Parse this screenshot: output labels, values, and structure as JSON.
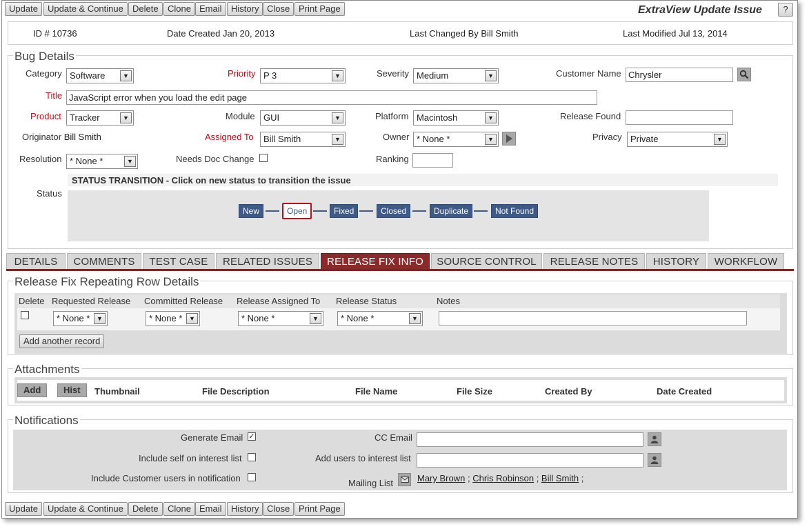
{
  "toolbar": {
    "buttons": [
      "Update",
      "Update & Continue",
      "Delete",
      "Clone",
      "Email",
      "History",
      "Close",
      "Print Page"
    ],
    "app_title": "ExtraView Update Issue",
    "help_label": "?"
  },
  "summary": {
    "id_label": "ID #",
    "id_value": "10736",
    "date_created_label": "Date Created",
    "date_created_value": "Jan 20, 2013",
    "last_changed_by_label": "Last Changed By",
    "last_changed_by_value": "Bill Smith",
    "last_modified_label": "Last Modified",
    "last_modified_value": "Jul 13, 2014"
  },
  "bug_details": {
    "title": "Bug Details",
    "category": {
      "label": "Category",
      "value": "Software"
    },
    "priority": {
      "label": "Priority",
      "value": "P 3"
    },
    "severity": {
      "label": "Severity",
      "value": "Medium"
    },
    "customer_name": {
      "label": "Customer Name",
      "value": "Chrysler"
    },
    "title_field": {
      "label": "Title",
      "value": "JavaScript error when you load the edit page"
    },
    "product": {
      "label": "Product",
      "value": "Tracker"
    },
    "module": {
      "label": "Module",
      "value": "GUI"
    },
    "platform": {
      "label": "Platform",
      "value": "Macintosh"
    },
    "release_found": {
      "label": "Release Found",
      "value": ""
    },
    "originator": {
      "label": "Originator",
      "value": "Bill Smith"
    },
    "assigned_to": {
      "label": "Assigned To",
      "value": "Bill Smith"
    },
    "owner": {
      "label": "Owner",
      "value": "* None *"
    },
    "privacy": {
      "label": "Privacy",
      "value": "Private"
    },
    "resolution": {
      "label": "Resolution",
      "value": "* None *"
    },
    "needs_doc_change": {
      "label": "Needs Doc Change",
      "checked": false
    },
    "ranking": {
      "label": "Ranking",
      "value": ""
    },
    "status_transition_label": "STATUS TRANSITION - Click on new status to transition the issue",
    "status_label": "Status",
    "statuses": [
      "New",
      "Open",
      "Fixed",
      "Closed",
      "Duplicate",
      "Not Found"
    ],
    "current_status": "Open"
  },
  "tabs": [
    "DETAILS",
    "COMMENTS",
    "TEST CASE",
    "RELATED ISSUES",
    "RELEASE FIX INFO",
    "SOURCE CONTROL",
    "RELEASE NOTES",
    "HISTORY",
    "WORKFLOW"
  ],
  "active_tab": "RELEASE FIX INFO",
  "release_fix": {
    "title": "Release Fix Repeating Row Details",
    "headers": [
      "Delete",
      "Requested Release",
      "Committed Release",
      "Release Assigned To",
      "Release Status",
      "Notes"
    ],
    "row": {
      "requested_release": "* None *",
      "committed_release": "* None *",
      "release_assigned_to": "* None *",
      "release_status": "* None *",
      "notes": ""
    },
    "add_record_label": "Add another record"
  },
  "attachments": {
    "title": "Attachments",
    "add_label": "Add",
    "hist_label": "Hist",
    "headers": [
      "Thumbnail",
      "File Description",
      "File Name",
      "File Size",
      "Created By",
      "Date Created"
    ]
  },
  "notifications": {
    "title": "Notifications",
    "generate_email": {
      "label": "Generate Email",
      "checked": true
    },
    "include_self": {
      "label": "Include self on interest list",
      "checked": false
    },
    "include_customer": {
      "label": "Include Customer users in notification",
      "checked": false
    },
    "cc_email": {
      "label": "CC Email",
      "value": ""
    },
    "add_users": {
      "label": "Add users to interest list",
      "value": ""
    },
    "mailing_list_label": "Mailing List",
    "mailing_list": [
      "Mary Brown",
      "Chris Robinson",
      "Bill Smith"
    ]
  }
}
